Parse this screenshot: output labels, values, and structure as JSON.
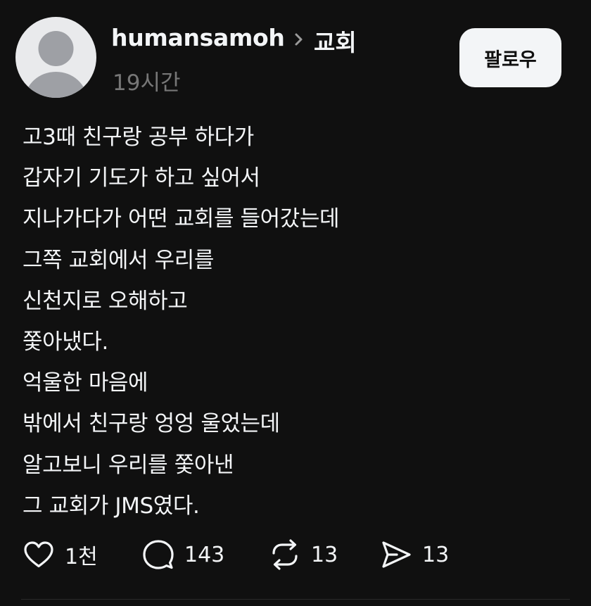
{
  "post": {
    "username": "humansamoh",
    "topic": "교회",
    "time": "19시간",
    "follow_label": "팔로우",
    "lines": [
      "고3때 친구랑 공부 하다가",
      "갑자기 기도가 하고 싶어서",
      "지나가다가 어떤 교회를 들어갔는데",
      "그쪽 교회에서 우리를",
      "신천지로 오해하고",
      "쫓아냈다.",
      "억울한 마음에",
      "밖에서 친구랑 엉엉 울었는데",
      "알고보니 우리를 쫓아낸",
      "그 교회가 JMS였다."
    ]
  },
  "actions": {
    "like_count": "1천",
    "comment_count": "143",
    "repost_count": "13",
    "share_count": "13"
  },
  "icons": {
    "avatar": "default-avatar-icon",
    "chevron": "chevron-right-icon",
    "like": "heart-icon",
    "comment": "comment-bubble-icon",
    "repost": "repost-icon",
    "share": "send-icon"
  },
  "colors": {
    "background": "#101010",
    "text": "#f3f5f7",
    "muted": "#777777",
    "avatar_bg": "#e9eaec",
    "avatar_figure": "#9ea0a5",
    "button_bg": "#f3f5f7"
  }
}
